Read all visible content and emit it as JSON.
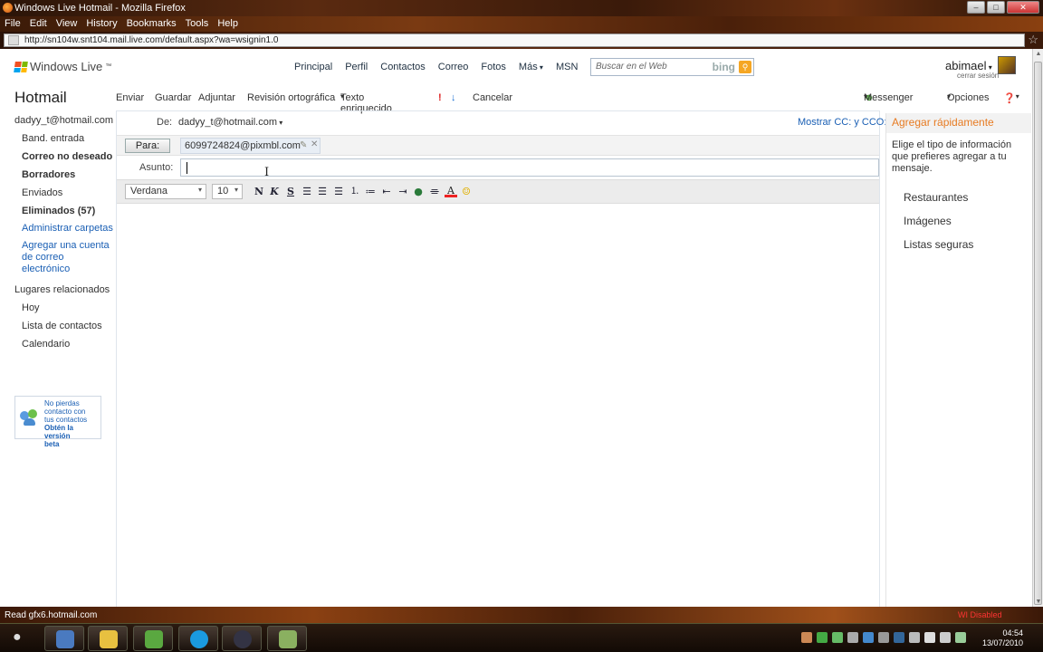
{
  "window": {
    "title": "Windows Live Hotmail - Mozilla Firefox",
    "url": "http://sn104w.snt104.mail.live.com/default.aspx?wa=wsignin1.0",
    "menu": [
      "File",
      "Edit",
      "View",
      "History",
      "Bookmarks",
      "Tools",
      "Help"
    ],
    "status": "Read gfx6.hotmail.com",
    "wi_status": "WI Disabled"
  },
  "header": {
    "brand": "Windows Live",
    "brand_tm": "™",
    "nav": [
      "Principal",
      "Perfil",
      "Contactos",
      "Correo",
      "Fotos",
      "Más",
      "MSN"
    ],
    "search_placeholder": "Buscar en el Web",
    "search_engine": "bing",
    "user": "abimael",
    "signout": "cerrar sesión"
  },
  "sidebar": {
    "title": "Hotmail",
    "account": "dadyy_t@hotmail.com",
    "folders": [
      {
        "label": "Band. entrada",
        "bold": false
      },
      {
        "label": "Correo no deseado",
        "bold": true
      },
      {
        "label": "Borradores",
        "bold": true
      },
      {
        "label": "Enviados",
        "bold": false
      },
      {
        "label": "Eliminados (57)",
        "bold": true
      }
    ],
    "manage_folders": "Administrar carpetas",
    "add_account_1": "Agregar una cuenta",
    "add_account_2": "de correo",
    "add_account_3": "electrónico",
    "related_title": "Lugares relacionados",
    "related": [
      "Hoy",
      "Lista de contactos",
      "Calendario"
    ],
    "promo_1": "No pierdas",
    "promo_2": "contacto con",
    "promo_3": "tus contactos",
    "promo_4": "Obtén la versión",
    "promo_5": "beta"
  },
  "toolbar": {
    "send": "Enviar",
    "save": "Guardar",
    "attach": "Adjuntar",
    "spellcheck": "Revisión ortográfica",
    "richtext": "Texto enriquecido",
    "cancel": "Cancelar",
    "messenger": "Messenger",
    "options": "Opciones"
  },
  "compose": {
    "from_label": "De:",
    "from_value": "dadyy_t@hotmail.com",
    "show_cc": "Mostrar CC: y CCO:",
    "to_button": "Para:",
    "recipient": "6099724824@pixmbl.com",
    "subject_label": "Asunto:",
    "subject_value": "",
    "font": "Verdana",
    "size": "10",
    "bold": "N",
    "italic": "K",
    "underline": "S"
  },
  "quickadd": {
    "title": "Agregar rápidamente",
    "desc": "Elige el tipo de información que prefieres agregar a tu mensaje.",
    "options": [
      "Restaurantes",
      "Imágenes",
      "Listas seguras"
    ]
  },
  "taskbar": {
    "time": "04:54",
    "date": "13/07/2010"
  },
  "colors": {
    "link": "#1a5fb4",
    "accent_orange": "#e77b22",
    "importance_red": "#d22",
    "importance_blue": "#1a6fd4"
  }
}
